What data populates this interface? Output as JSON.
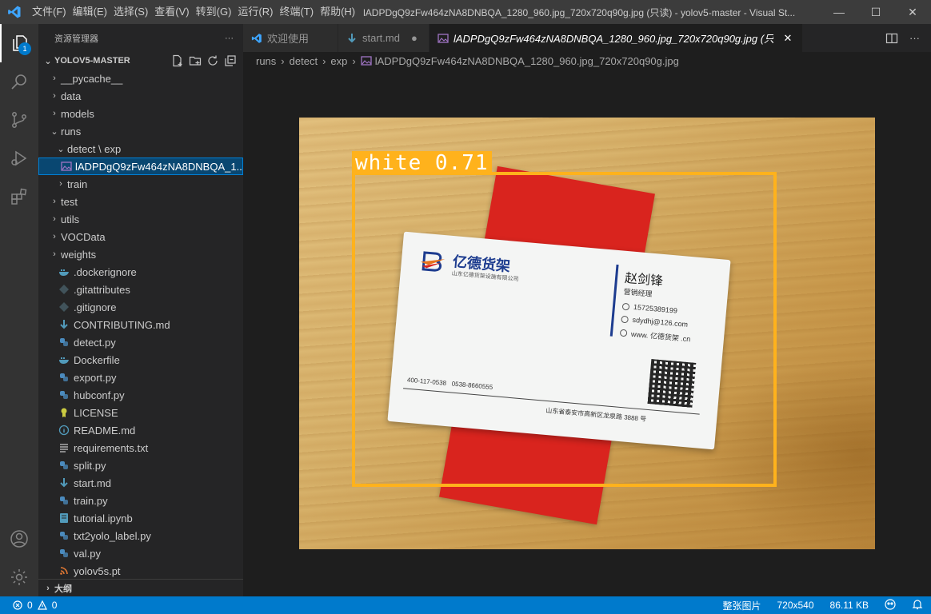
{
  "titlebar": {
    "menu": [
      "文件(F)",
      "编辑(E)",
      "选择(S)",
      "查看(V)",
      "转到(G)",
      "运行(R)",
      "终端(T)",
      "帮助(H)"
    ],
    "window_title": "lADPDgQ9zFw464zNA8DNBQA_1280_960.jpg_720x720q90g.jpg (只读) - yolov5-master - Visual St...",
    "controls": [
      "—",
      "☐",
      "✕"
    ]
  },
  "sidebar": {
    "header": "资源管理器",
    "more": "···",
    "section": "YOLOV5-MASTER",
    "outline": "大纲",
    "tree": [
      {
        "label": "__pycache__",
        "type": "folder",
        "open": false,
        "indent": 1
      },
      {
        "label": "data",
        "type": "folder",
        "open": false,
        "indent": 1
      },
      {
        "label": "models",
        "type": "folder",
        "open": false,
        "indent": 1
      },
      {
        "label": "runs",
        "type": "folder",
        "open": true,
        "indent": 1
      },
      {
        "label": "detect \\ exp",
        "type": "folder",
        "open": true,
        "indent": 2
      },
      {
        "label": "lADPDgQ9zFw464zNA8DNBQA_1...",
        "type": "image",
        "indent": 3,
        "selected": true
      },
      {
        "label": "train",
        "type": "folder",
        "open": false,
        "indent": 2
      },
      {
        "label": "test",
        "type": "folder",
        "open": false,
        "indent": 1
      },
      {
        "label": "utils",
        "type": "folder",
        "open": false,
        "indent": 1
      },
      {
        "label": "VOCData",
        "type": "folder",
        "open": false,
        "indent": 1
      },
      {
        "label": "weights",
        "type": "folder",
        "open": false,
        "indent": 1
      },
      {
        "label": ".dockerignore",
        "type": "docker",
        "indent": 1
      },
      {
        "label": ".gitattributes",
        "type": "git",
        "indent": 1
      },
      {
        "label": ".gitignore",
        "type": "git",
        "indent": 1
      },
      {
        "label": "CONTRIBUTING.md",
        "type": "md",
        "indent": 1
      },
      {
        "label": "detect.py",
        "type": "py",
        "indent": 1
      },
      {
        "label": "Dockerfile",
        "type": "docker",
        "indent": 1
      },
      {
        "label": "export.py",
        "type": "py",
        "indent": 1
      },
      {
        "label": "hubconf.py",
        "type": "py",
        "indent": 1
      },
      {
        "label": "LICENSE",
        "type": "license",
        "indent": 1
      },
      {
        "label": "README.md",
        "type": "info",
        "indent": 1
      },
      {
        "label": "requirements.txt",
        "type": "txt",
        "indent": 1
      },
      {
        "label": "split.py",
        "type": "py",
        "indent": 1
      },
      {
        "label": "start.md",
        "type": "md",
        "indent": 1
      },
      {
        "label": "train.py",
        "type": "py",
        "indent": 1
      },
      {
        "label": "tutorial.ipynb",
        "type": "ipynb",
        "indent": 1
      },
      {
        "label": "txt2yolo_label.py",
        "type": "py",
        "indent": 1
      },
      {
        "label": "val.py",
        "type": "py",
        "indent": 1
      },
      {
        "label": "yolov5s.pt",
        "type": "pt",
        "indent": 1
      }
    ]
  },
  "activity": {
    "badge": "1"
  },
  "tabs": [
    {
      "label": "欢迎使用",
      "icon": "vscode-icon",
      "active": false,
      "close": ""
    },
    {
      "label": "start.md",
      "icon": "markdown-icon",
      "active": false,
      "close": "●"
    },
    {
      "label": "lADPDgQ9zFw464zNA8DNBQA_1280_960.jpg_720x720q90g.jpg (只读)",
      "icon": "image-icon",
      "active": true,
      "close": "✕"
    }
  ],
  "breadcrumb": [
    "runs",
    "detect",
    "exp",
    "lADPDgQ9zFw464zNA8DNBQA_1280_960.jpg_720x720q90g.jpg"
  ],
  "image": {
    "detection_label": "white 0.71",
    "detection_color": "#ffb21c",
    "card": {
      "company": "亿德货架",
      "company_sub": "山东亿德货架设施有限公司",
      "name": "赵剑锋",
      "title": "营销经理",
      "phone": "15725389199",
      "email": "sdydhj@126.com",
      "web": "www. 亿德货架 .cn",
      "tel1": "400-117-0538",
      "tel2": "0538-8660555",
      "address": "山东省泰安市高新区龙泉路 3888 号"
    }
  },
  "statusbar": {
    "errors": "0",
    "warnings": "0",
    "zoom": "整张图片",
    "dimensions": "720x540",
    "size": "86.11 KB"
  },
  "colors": {
    "accent": "#007acc",
    "selection": "#094771"
  }
}
